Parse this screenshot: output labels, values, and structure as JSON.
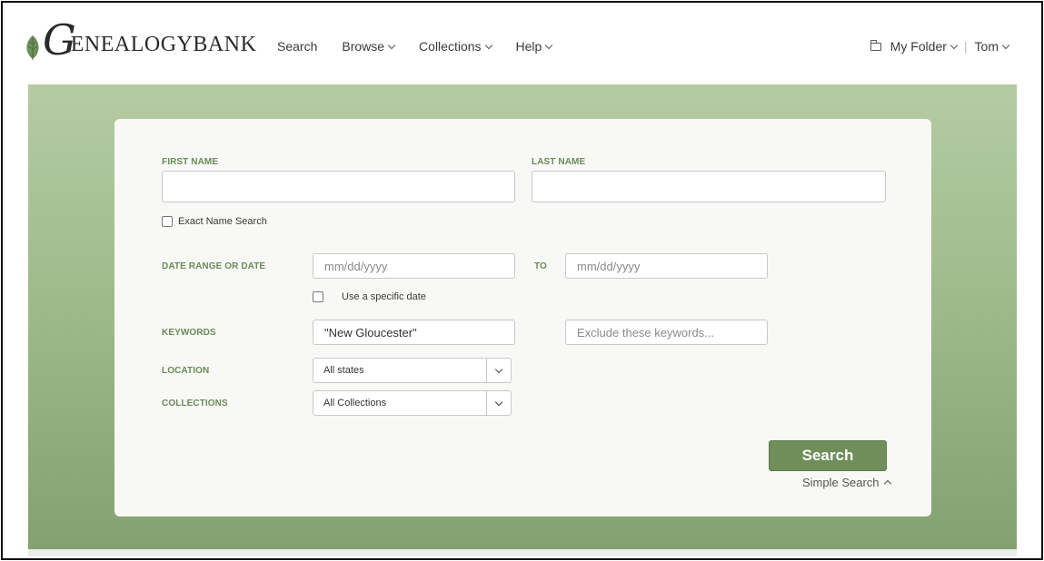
{
  "header": {
    "logo_initial": "G",
    "logo_text": "ENEALOGYBANK",
    "nav": [
      {
        "label": "Search",
        "has_dropdown": false
      },
      {
        "label": "Browse",
        "has_dropdown": true
      },
      {
        "label": "Collections",
        "has_dropdown": true
      },
      {
        "label": "Help",
        "has_dropdown": true
      }
    ],
    "my_folder": "My Folder",
    "user": "Tom"
  },
  "form": {
    "first_name": {
      "label": "FIRST NAME",
      "value": ""
    },
    "last_name": {
      "label": "LAST NAME",
      "value": ""
    },
    "exact_name": {
      "label": "Exact Name Search",
      "checked": false
    },
    "date_range": {
      "label": "DATE RANGE OR DATE",
      "from_placeholder": "mm/dd/yyyy",
      "to_label": "TO",
      "to_placeholder": "mm/dd/yyyy"
    },
    "specific_date": {
      "label": "Use a specific date",
      "checked": false
    },
    "keywords": {
      "label": "KEYWORDS",
      "value": "\"New Gloucester\"",
      "exclude_placeholder": "Exclude these keywords..."
    },
    "location": {
      "label": "LOCATION",
      "selected": "All states"
    },
    "collections": {
      "label": "COLLECTIONS",
      "selected": "All Collections"
    },
    "search_button": "Search",
    "simple_search": "Simple Search"
  },
  "colors": {
    "accent": "#6f8e5a",
    "label": "#6b8a57",
    "band_top": "#b5cba3",
    "band_bottom": "#83a26f"
  }
}
